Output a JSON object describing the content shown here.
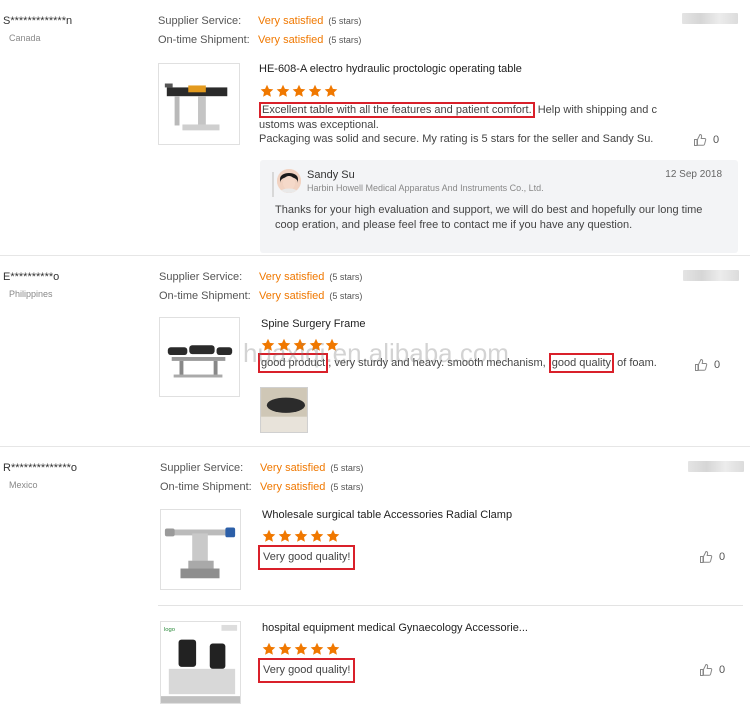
{
  "colors": {
    "accent": "#f07800",
    "highlight": "#d9202a",
    "star": "#f07800"
  },
  "watermark": "huaxiqi.en.alibaba.com",
  "reviews": [
    {
      "buyer": "S*************n",
      "country": "Canada",
      "supplier_service_label": "Supplier Service:",
      "supplier_service_value": "Very satisfied",
      "supplier_service_stars": "(5 stars)",
      "ontime_label": "On-time Shipment:",
      "ontime_value": "Very satisfied",
      "ontime_stars": "(5 stars)",
      "products": [
        {
          "title": "HE-608-A electro hydraulic proctologic operating table",
          "rating": 5,
          "review_highlight": "Excellent table with all the features and patient comfort.",
          "review_line1_rest": " Help with shipping and c",
          "review_line2": "ustoms was exceptional.",
          "review_line3": "Packaging was solid and secure. My rating is 5 stars for the seller and Sandy Su.",
          "helpful_count": "0"
        }
      ],
      "reply": {
        "name": "Sandy Su",
        "company": "Harbin Howell Medical Apparatus And Instruments Co., Ltd.",
        "date": "12 Sep 2018",
        "text": "Thanks for your high evaluation and support, we will do best and hopefully our long time coop eration, and please feel free to contact me if you have any question."
      }
    },
    {
      "buyer": "E**********o",
      "country": "Philippines",
      "supplier_service_label": "Supplier Service:",
      "supplier_service_value": "Very satisfied",
      "supplier_service_stars": "(5 stars)",
      "ontime_label": "On-time Shipment:",
      "ontime_value": "Very satisfied",
      "ontime_stars": "(5 stars)",
      "products": [
        {
          "title": "Spine Surgery Frame",
          "rating": 5,
          "review_hl1": "good product",
          "review_mid": ", very sturdy and heavy. smooth mechanism, ",
          "review_hl2": "good quality",
          "review_end": " of foam.",
          "helpful_count": "0"
        }
      ]
    },
    {
      "buyer": "R**************o",
      "country": "Mexico",
      "supplier_service_label": "Supplier Service:",
      "supplier_service_value": "Very satisfied",
      "supplier_service_stars": "(5 stars)",
      "ontime_label": "On-time Shipment:",
      "ontime_value": "Very satisfied",
      "ontime_stars": "(5 stars)",
      "products": [
        {
          "title": "Wholesale surgical table Accessories Radial Clamp",
          "rating": 5,
          "review_text": "Very good quality!",
          "helpful_count": "0"
        },
        {
          "title": "hospital equipment medical Gynaecology Accessorie...",
          "rating": 5,
          "review_text": "Very good quality!",
          "helpful_count": "0"
        }
      ]
    }
  ]
}
